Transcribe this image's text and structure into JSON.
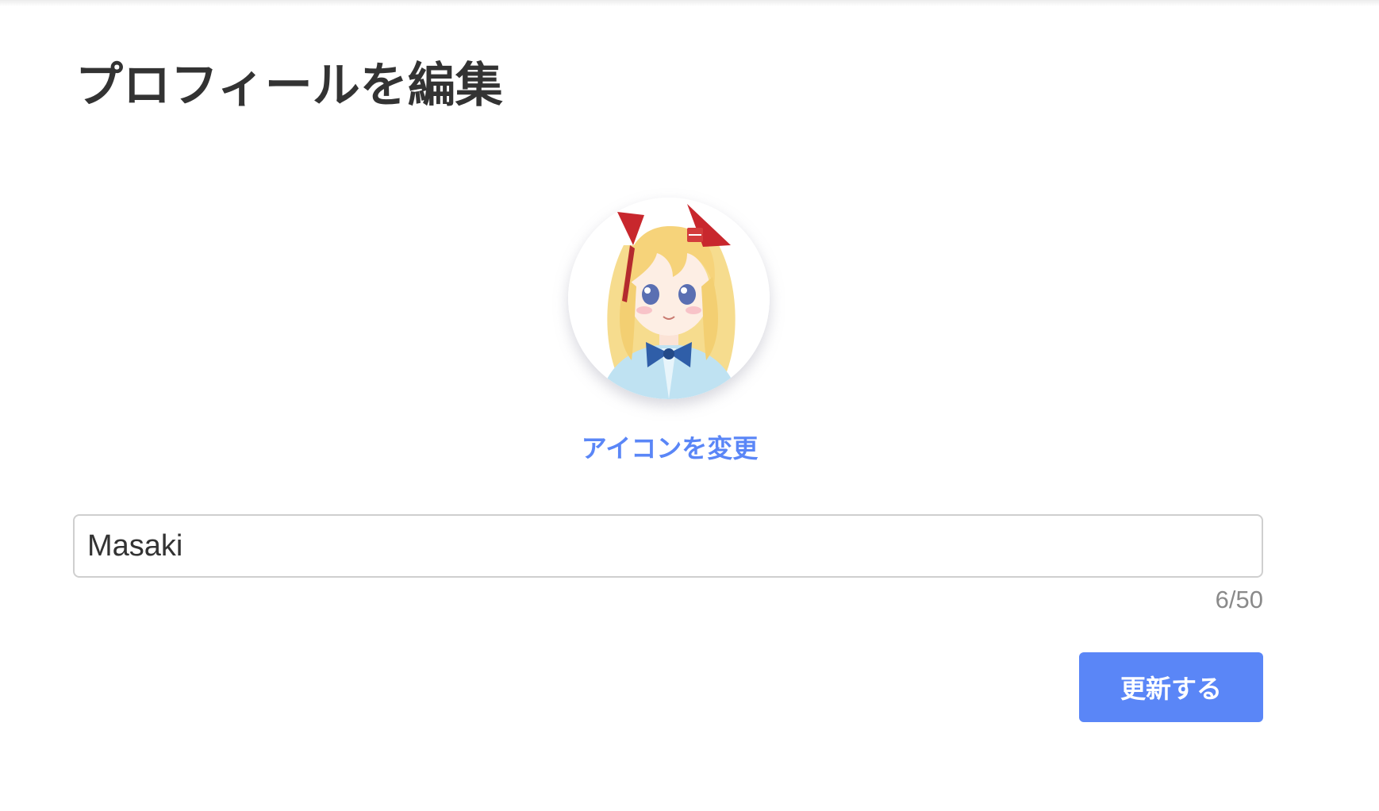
{
  "page": {
    "title": "プロフィールを編集"
  },
  "avatar": {
    "change_label": "アイコンを変更"
  },
  "name_field": {
    "value": "Masaki",
    "counter": "6/50"
  },
  "actions": {
    "submit_label": "更新する"
  },
  "colors": {
    "accent": "#5a86f7",
    "title_text": "#333333",
    "counter_text": "#8a8a8a",
    "border": "#cfcfcf"
  }
}
